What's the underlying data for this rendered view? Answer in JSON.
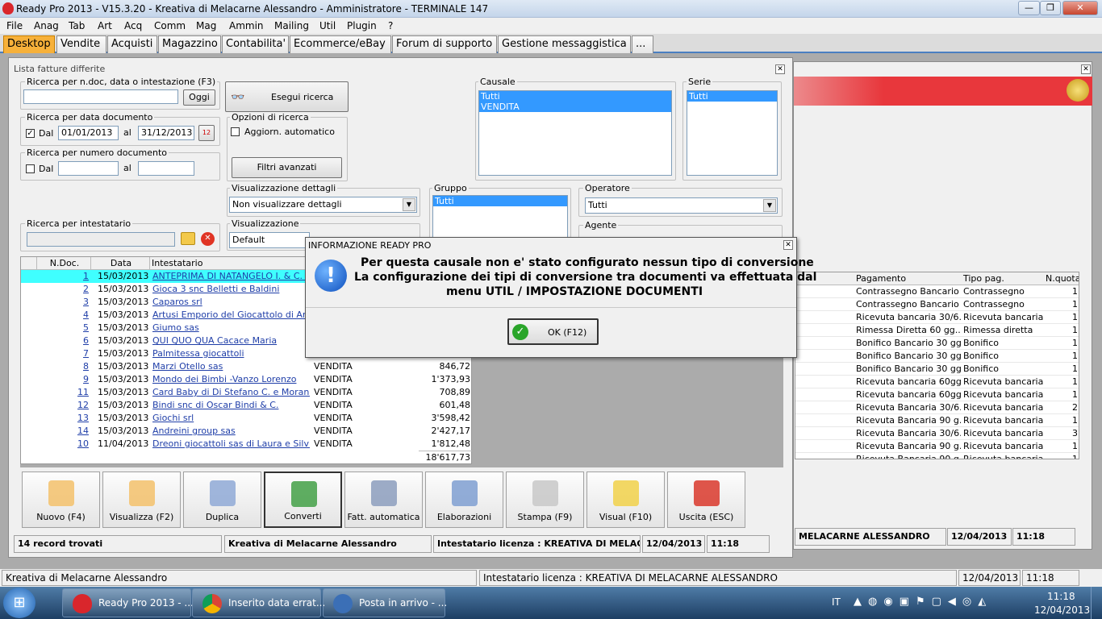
{
  "window": {
    "title": "Ready Pro 2013 - V15.3.20 - Kreativa di Melacarne Alessandro - Amministratore - TERMINALE 147"
  },
  "menu": [
    "File",
    "Anag",
    "Tab",
    "Art",
    "Acq",
    "Comm",
    "Mag",
    "Ammin",
    "Mailing",
    "Util",
    "Plugin",
    "?"
  ],
  "tabs": [
    "Desktop",
    "Vendite",
    "Acquisti",
    "Magazzino",
    "Contabilita'",
    "Ecommerce/eBay",
    "Forum di supporto",
    "Gestione messaggistica",
    "..."
  ],
  "panel": {
    "title": "Lista fatture differite",
    "search_doc_label": "Ricerca per n.doc, data o intestazione (F3)",
    "search_doc_value": "",
    "oggi_button": "Oggi",
    "execute_button": "Esegui ricerca",
    "date_group_label": "Ricerca per data documento",
    "date_from_label": "Dal",
    "date_from": "01/01/2013",
    "date_to_label": "al",
    "date_to": "31/12/2013",
    "num_group_label": "Ricerca per numero documento",
    "num_from_label": "Dal",
    "num_to_label": "al",
    "options_label": "Opzioni di ricerca",
    "auto_update_label": "Aggiorn. automatico",
    "advanced_filters": "Filtri avanzati",
    "causale_label": "Causale",
    "causale_items": [
      "Tutti",
      "VENDITA"
    ],
    "serie_label": "Serie",
    "serie_items": [
      "Tutti"
    ],
    "details_label": "Visualizzazione dettagli",
    "details_value": "Non visualizzare dettagli",
    "gruppo_label": "Gruppo",
    "gruppo_items": [
      "Tutti"
    ],
    "operatore_label": "Operatore",
    "operatore_value": "Tutti",
    "agente_label": "Agente",
    "intestatario_label": "Ricerca per intestatario",
    "view_label": "Visualizzazione",
    "view_value": "Default"
  },
  "grid": {
    "headers": [
      "N.Doc.",
      "Data",
      "Intestatario"
    ],
    "rows": [
      {
        "n": "1",
        "date": "15/03/2013",
        "name": "ANTEPRIMA DI NATANGELO I. & C. S...",
        "causale": "",
        "amt": ""
      },
      {
        "n": "2",
        "date": "15/03/2013",
        "name": "Gioca 3 snc Belletti e Baldini",
        "causale": "",
        "amt": ""
      },
      {
        "n": "3",
        "date": "15/03/2013",
        "name": "Caparos srl",
        "causale": "",
        "amt": ""
      },
      {
        "n": "4",
        "date": "15/03/2013",
        "name": "Artusi Emporio del Giocattolo di Artusi ...",
        "causale": "",
        "amt": ""
      },
      {
        "n": "5",
        "date": "15/03/2013",
        "name": "Giumo sas",
        "causale": "",
        "amt": ""
      },
      {
        "n": "6",
        "date": "15/03/2013",
        "name": "QUI QUO QUA Cacace Maria",
        "causale": "",
        "amt": ""
      },
      {
        "n": "7",
        "date": "15/03/2013",
        "name": "Palmitessa giocattoli",
        "causale": "",
        "amt": ""
      },
      {
        "n": "8",
        "date": "15/03/2013",
        "name": "Marzi Otello sas",
        "causale": "VENDITA",
        "amt": "846,72"
      },
      {
        "n": "9",
        "date": "15/03/2013",
        "name": "Mondo dei Bimbi -Vanzo Lorenzo",
        "causale": "VENDITA",
        "amt": "1'373,93"
      },
      {
        "n": "11",
        "date": "15/03/2013",
        "name": "Card Baby di Di Stefano C. e Morana ...",
        "causale": "VENDITA",
        "amt": "708,89"
      },
      {
        "n": "12",
        "date": "15/03/2013",
        "name": "Bindi snc di Oscar Bindi & C.",
        "causale": "VENDITA",
        "amt": "601,48"
      },
      {
        "n": "13",
        "date": "15/03/2013",
        "name": "Giochi srl",
        "causale": "VENDITA",
        "amt": "3'598,42"
      },
      {
        "n": "14",
        "date": "15/03/2013",
        "name": "Andreini group sas",
        "causale": "VENDITA",
        "amt": "2'427,17"
      },
      {
        "n": "10",
        "date": "11/04/2013",
        "name": "Dreoni giocattoli sas di Laura e Silvia ...",
        "causale": "VENDITA",
        "amt": "1'812,48"
      }
    ],
    "total": "18'617,73"
  },
  "rgrid": {
    "headers": [
      "Pagamento",
      "Tipo pag.",
      "N.quota"
    ],
    "rows": [
      [
        "Contrassegno Bancario ...",
        "Contrassegno",
        "1"
      ],
      [
        "Contrassegno Bancario ...",
        "Contrassegno",
        "1"
      ],
      [
        "Ricevuta bancaria 30/6...",
        "Ricevuta bancaria",
        "1"
      ],
      [
        "Rimessa Diretta 60 gg....",
        "Rimessa diretta",
        "1"
      ],
      [
        "Bonifico Bancario 30 gg...",
        "Bonifico",
        "1"
      ],
      [
        "Bonifico Bancario 30 gg...",
        "Bonifico",
        "1"
      ],
      [
        "Bonifico Bancario 30 gg...",
        "Bonifico",
        "1"
      ],
      [
        "Ricevuta bancaria 60gg...",
        "Ricevuta bancaria",
        "1"
      ],
      [
        "Ricevuta bancaria 60gg...",
        "Ricevuta bancaria",
        "1"
      ],
      [
        "Ricevuta Bancaria 30/6...",
        "Ricevuta bancaria",
        "2"
      ],
      [
        "Ricevuta Bancaria 90 g...",
        "Ricevuta bancaria",
        "1"
      ],
      [
        "Ricevuta Bancaria 30/6...",
        "Ricevuta bancaria",
        "3"
      ],
      [
        "Ricevuta Bancaria 90 g...",
        "Ricevuta bancaria",
        "1"
      ],
      [
        "Ricevuta Bancaria 90 g...",
        "Ricevuta bancaria",
        "1"
      ]
    ]
  },
  "toolbar": [
    "Nuovo (F4)",
    "Visualizza (F2)",
    "Duplica",
    "Converti",
    "Fatt. automatica",
    "Elaborazioni",
    "Stampa (F9)",
    "Visual (F10)",
    "Uscita (ESC)"
  ],
  "panel_status": {
    "records": "14 record trovati",
    "company": "Kreativa di Melacarne Alessandro",
    "license": "Intestatario licenza : KREATIVA DI MELACARNE ALESSANDRO",
    "date": "12/04/2013",
    "time": "11:18"
  },
  "right_status": {
    "license": "MELACARNE ALESSANDRO",
    "date": "12/04/2013",
    "time": "11:18"
  },
  "global_status": {
    "company": "Kreativa di Melacarne Alessandro",
    "license": "Intestatario licenza : KREATIVA DI MELACARNE ALESSANDRO",
    "date": "12/04/2013",
    "time": "11:18"
  },
  "dialog": {
    "title": "INFORMAZIONE READY PRO",
    "line1": "Per questa causale non e' stato configurato nessun tipo di conversione",
    "line2": "La configurazione dei tipi di conversione tra documenti va effettuata dal",
    "line3": "menu UTIL / IMPOSTAZIONE DOCUMENTI",
    "ok": "OK (F12)"
  },
  "taskbar": {
    "items": [
      "Ready Pro 2013 - ...",
      "Inserito data errat...",
      "Posta in arrivo - ..."
    ],
    "lang": "IT",
    "time": "11:18",
    "date": "12/04/2013"
  },
  "colors": {
    "accent": "#3399ff",
    "tab_active": "#f7b13a",
    "selected_row": "#3fffff",
    "banner": "#e8373c"
  }
}
